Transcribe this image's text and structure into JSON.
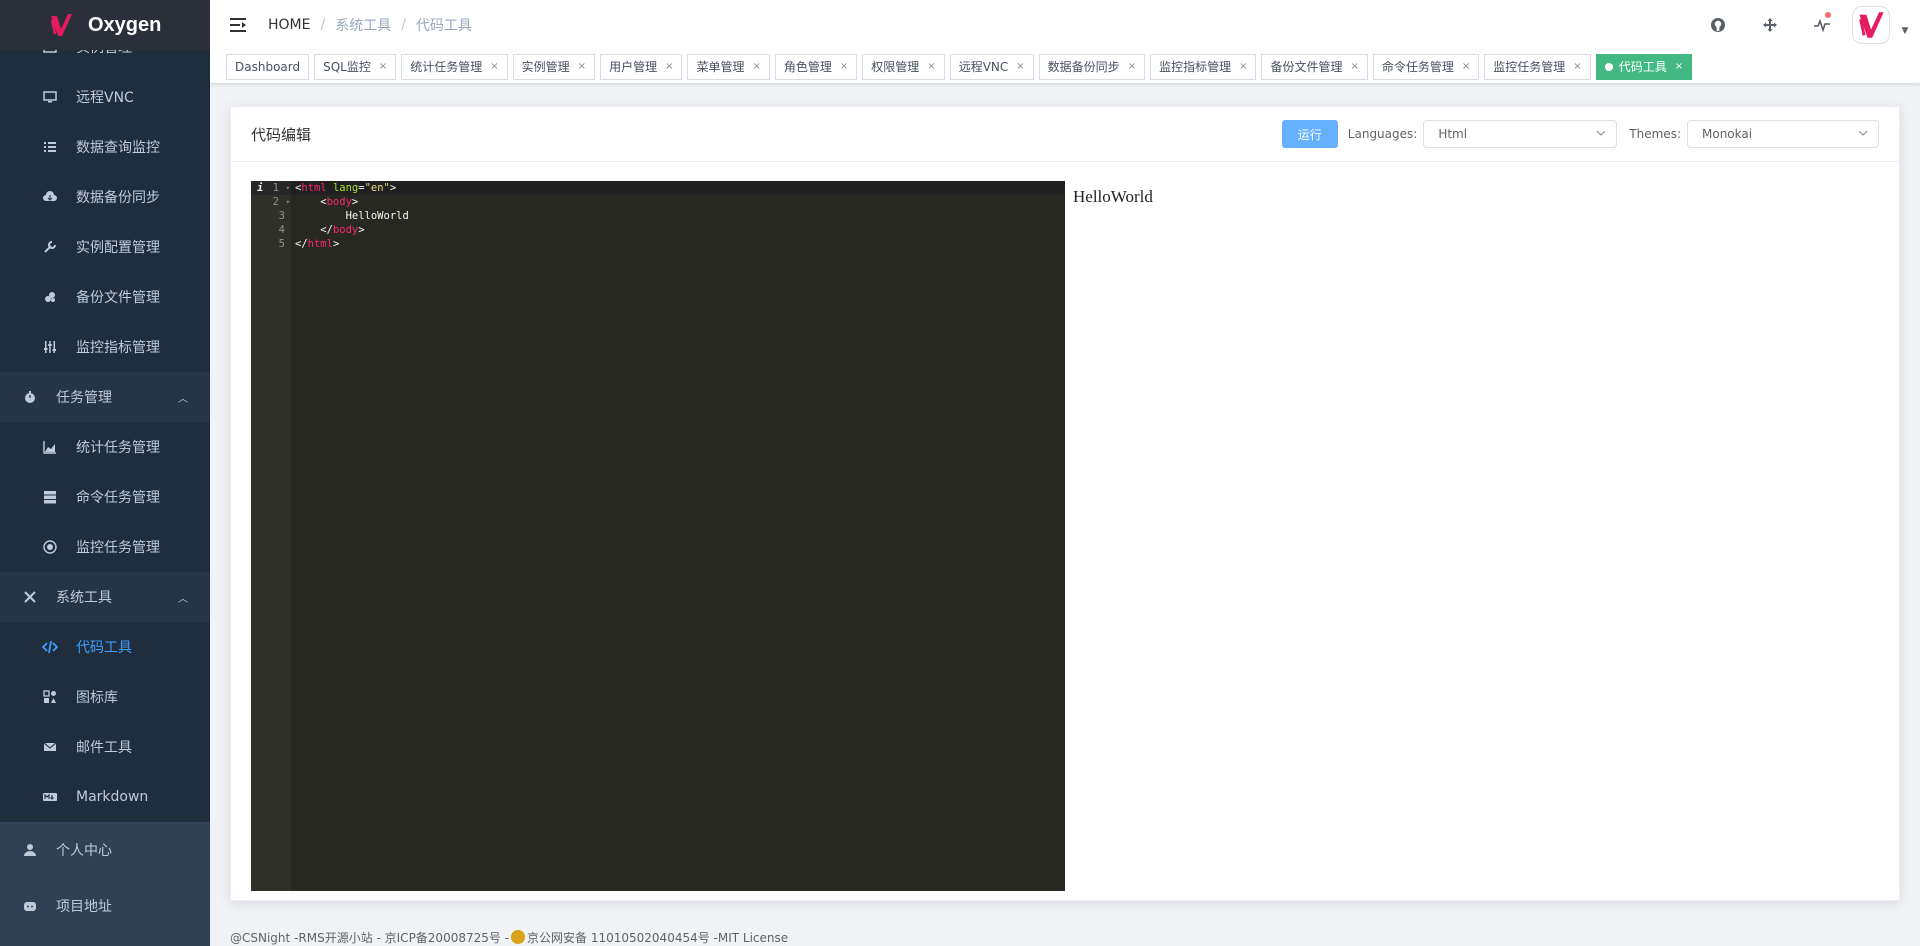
{
  "app": {
    "name": "Oxygen",
    "brand_color": "#e51c5e"
  },
  "sidebar": {
    "top_items": [
      {
        "label": "实例管理",
        "icon": "instance-icon"
      },
      {
        "label": "远程VNC",
        "icon": "monitor-icon"
      },
      {
        "label": "数据查询监控",
        "icon": "list-icon"
      },
      {
        "label": "数据备份同步",
        "icon": "cloud-download-icon"
      },
      {
        "label": "实例配置管理",
        "icon": "wrench-icon"
      },
      {
        "label": "备份文件管理",
        "icon": "backup-icon"
      },
      {
        "label": "监控指标管理",
        "icon": "sliders-icon"
      }
    ],
    "task_group": {
      "label": "任务管理",
      "icon": "stopwatch-icon",
      "arrow": "︿"
    },
    "task_items": [
      {
        "label": "统计任务管理",
        "icon": "area-chart-icon"
      },
      {
        "label": "命令任务管理",
        "icon": "server-icon"
      },
      {
        "label": "监控任务管理",
        "icon": "monitor-task-icon"
      }
    ],
    "system_group": {
      "label": "系统工具",
      "icon": "tools-icon",
      "arrow": "︿"
    },
    "system_items": [
      {
        "label": "代码工具",
        "icon": "code-icon",
        "active": true
      },
      {
        "label": "图标库",
        "icon": "icons-icon"
      },
      {
        "label": "邮件工具",
        "icon": "mail-icon"
      },
      {
        "label": "Markdown",
        "icon": "markdown-icon"
      }
    ],
    "bottom_items": [
      {
        "label": "个人中心",
        "icon": "user-icon"
      },
      {
        "label": "项目地址",
        "icon": "github-icon"
      }
    ]
  },
  "breadcrumb": [
    "HOME",
    "系统工具",
    "代码工具"
  ],
  "tags": [
    {
      "label": "Dashboard",
      "closable": false
    },
    {
      "label": "SQL监控",
      "closable": true
    },
    {
      "label": "统计任务管理",
      "closable": true
    },
    {
      "label": "实例管理",
      "closable": true
    },
    {
      "label": "用户管理",
      "closable": true
    },
    {
      "label": "菜单管理",
      "closable": true
    },
    {
      "label": "角色管理",
      "closable": true
    },
    {
      "label": "权限管理",
      "closable": true
    },
    {
      "label": "远程VNC",
      "closable": true
    },
    {
      "label": "数据备份同步",
      "closable": true
    },
    {
      "label": "监控指标管理",
      "closable": true
    },
    {
      "label": "备份文件管理",
      "closable": true
    },
    {
      "label": "命令任务管理",
      "closable": true
    },
    {
      "label": "监控任务管理",
      "closable": true
    },
    {
      "label": "代码工具",
      "closable": true,
      "active": true
    }
  ],
  "tag_close_glyph": "×",
  "card": {
    "title": "代码编辑",
    "run_label": "运行",
    "languages_label": "Languages:",
    "language_value": "Html",
    "themes_label": "Themes:",
    "theme_value": "Monokai"
  },
  "editor": {
    "info_glyph": "i",
    "line_numbers": [
      "1",
      "2",
      "3",
      "4",
      "5"
    ],
    "lines": [
      [
        [
          "p",
          "<"
        ],
        [
          "kw",
          "html"
        ],
        [
          "p",
          " "
        ],
        [
          "at",
          "lang"
        ],
        [
          "p",
          "="
        ],
        [
          "st",
          "\"en\""
        ],
        [
          "p",
          ">"
        ]
      ],
      [
        [
          "p",
          "    <"
        ],
        [
          "kw",
          "body"
        ],
        [
          "p",
          ">"
        ]
      ],
      [
        [
          "p",
          "        HelloWorld"
        ]
      ],
      [
        [
          "p",
          "    </"
        ],
        [
          "kw",
          "body"
        ],
        [
          "p",
          ">"
        ]
      ],
      [
        [
          "p",
          "</"
        ],
        [
          "kw",
          "html"
        ],
        [
          "p",
          ">"
        ]
      ]
    ]
  },
  "preview_text": "HelloWorld",
  "footer": {
    "part1": "@CSNight -RMS开源小站 - 京ICP备20008725号 -",
    "part2": "京公网安备 11010502040454号 -MIT License"
  }
}
